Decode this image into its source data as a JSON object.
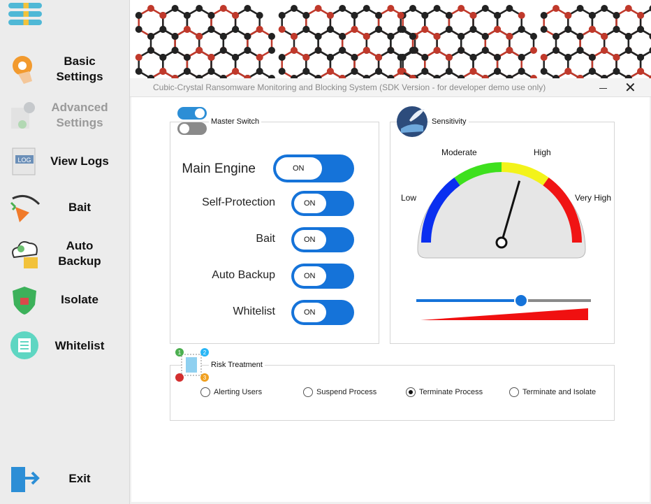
{
  "window": {
    "title": "Cubic-Crystal Ransomware Monitoring and Blocking System (SDK Version - for developer demo use only)",
    "close": "✕"
  },
  "sidebar": {
    "items": [
      {
        "label": "Basic Settings",
        "enabled": true
      },
      {
        "label": "Advanced Settings",
        "enabled": false
      },
      {
        "label": "View Logs",
        "enabled": true
      },
      {
        "label": "Bait",
        "enabled": true
      },
      {
        "label": "Auto Backup",
        "enabled": true
      },
      {
        "label": "Isolate",
        "enabled": true
      },
      {
        "label": "Whitelist",
        "enabled": true
      }
    ],
    "exit": "Exit",
    "log_icon_text": "LOG"
  },
  "master": {
    "title": "Master Switch",
    "switches": [
      {
        "label": "Main Engine",
        "state": "ON"
      },
      {
        "label": "Self-Protection",
        "state": "ON"
      },
      {
        "label": "Bait",
        "state": "ON"
      },
      {
        "label": "Auto Backup",
        "state": "ON"
      },
      {
        "label": "Whitelist",
        "state": "ON"
      }
    ]
  },
  "sensitivity": {
    "title": "Sensitivity",
    "levels": [
      "Low",
      "Moderate",
      "High",
      "Very High"
    ],
    "slider_value_fraction": 0.6
  },
  "risk": {
    "title": "Risk Treatment",
    "options": [
      "Alerting Users",
      "Suspend Process",
      "Terminate Process",
      "Terminate and Isolate"
    ],
    "selected": "Terminate Process",
    "badge_numbers": [
      "1",
      "2",
      "3"
    ]
  },
  "colors": {
    "accent": "#1573d9",
    "gauge_low": "#0a2ff0",
    "gauge_moderate": "#3ee01e",
    "gauge_high": "#f3f31a",
    "gauge_very_high": "#f01414"
  }
}
